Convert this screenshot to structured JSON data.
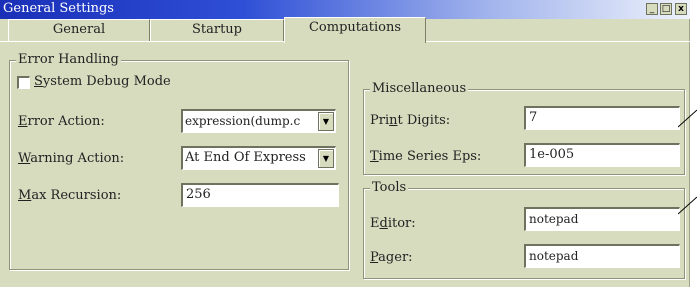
{
  "window": {
    "title": "General Settings",
    "controls": {
      "minimize": "_",
      "maximize": "□",
      "close": "x"
    }
  },
  "tabs": [
    {
      "label": "General",
      "active": false
    },
    {
      "label": "Startup",
      "active": false
    },
    {
      "label": "Computations",
      "active": true
    }
  ],
  "error_handling": {
    "title": "Error Handling",
    "system_debug": {
      "label_u": "S",
      "label_rest": "ystem Debug Mode",
      "checked": false
    },
    "error_action": {
      "label_u": "E",
      "label_rest": "rror Action:",
      "value": "expression(dump.c"
    },
    "warning_action": {
      "label_u": "W",
      "label_rest": "arning Action:",
      "value": "At End Of Express"
    },
    "max_recursion": {
      "label_u": "M",
      "label_rest": "ax Recursion:",
      "value": "256"
    }
  },
  "miscellaneous": {
    "title": "Miscellaneous",
    "print_digits": {
      "label_pre": "Pri",
      "label_u": "n",
      "label_rest": "t Digits:",
      "value": "7"
    },
    "time_series_eps": {
      "label_u": "T",
      "label_rest": "ime Series Eps:",
      "value": "1e-005"
    }
  },
  "tools": {
    "title": "Tools",
    "editor": {
      "label_pre": "E",
      "label_u": "d",
      "label_rest": "itor:",
      "value": "notepad"
    },
    "pager": {
      "label_u": "P",
      "label_rest": "ager:",
      "value": "notepad"
    }
  },
  "colors": {
    "face": "#d7dcbf",
    "title_start": "#1a2fb8",
    "title_end": "#eef2fb"
  }
}
